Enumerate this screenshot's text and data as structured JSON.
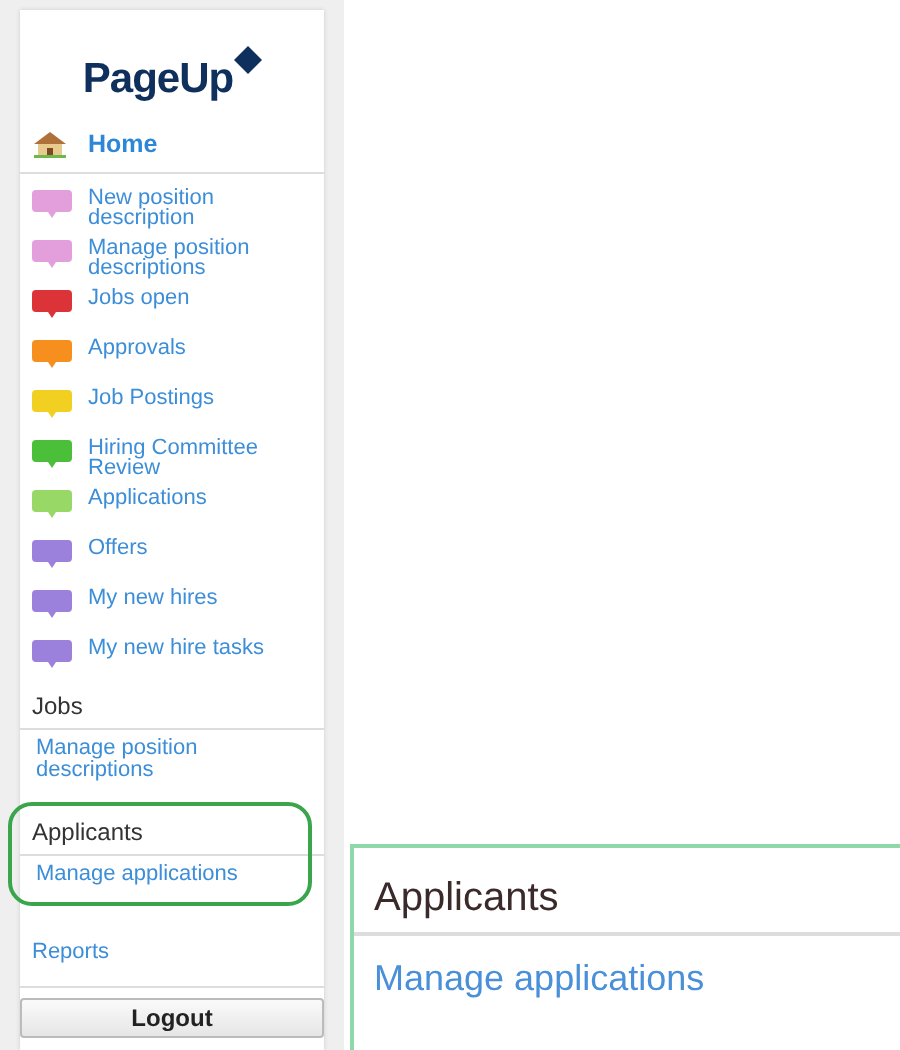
{
  "logo": {
    "text": "PageUp"
  },
  "home": {
    "label": "Home"
  },
  "menu_items": [
    {
      "label": "New position description",
      "color": "#e39fdc"
    },
    {
      "label": "Manage position descriptions",
      "color": "#e39fdc"
    },
    {
      "label": "Jobs open",
      "color": "#db3338"
    },
    {
      "label": "Approvals",
      "color": "#f78f1e"
    },
    {
      "label": "Job Postings",
      "color": "#f2d022"
    },
    {
      "label": "Hiring Committee Review",
      "color": "#4cbf3a"
    },
    {
      "label": "Applications",
      "color": "#98d866"
    },
    {
      "label": "Offers",
      "color": "#9b80dc"
    },
    {
      "label": "My new hires",
      "color": "#9b80dc"
    },
    {
      "label": "My new hire tasks",
      "color": "#9b80dc"
    }
  ],
  "sections": [
    {
      "title": "Jobs",
      "highlighted": false,
      "links": [
        "Manage position descriptions"
      ]
    },
    {
      "title": "Applicants",
      "highlighted": true,
      "links": [
        "Manage applications"
      ]
    }
  ],
  "reports": {
    "label": "Reports"
  },
  "logout": {
    "label": "Logout"
  },
  "zoom_panel": {
    "title": "Applicants",
    "link": "Manage applications"
  }
}
